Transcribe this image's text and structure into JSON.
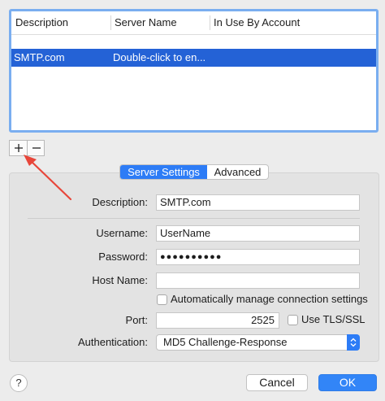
{
  "table": {
    "columns": [
      "Description",
      "Server Name",
      "In Use By Account"
    ],
    "rows": [
      {
        "description": "SMTP.com",
        "server_name": "Double-click to en...",
        "in_use_by": "",
        "selected": true
      }
    ]
  },
  "list_buttons": {
    "add_label": "+",
    "remove_label": "−"
  },
  "tabs": {
    "server_settings": "Server Settings",
    "advanced": "Advanced",
    "selected": "Server Settings"
  },
  "form": {
    "description": {
      "label": "Description:",
      "value": "SMTP.com"
    },
    "username": {
      "label": "Username:",
      "value": "UserName"
    },
    "password": {
      "label": "Password:",
      "value": "●●●●●●●●●●"
    },
    "host_name": {
      "label": "Host Name:",
      "value": ""
    },
    "auto_manage": {
      "label": "Automatically manage connection settings",
      "checked": false
    },
    "port": {
      "label": "Port:",
      "value": "2525"
    },
    "use_tls": {
      "label": "Use TLS/SSL",
      "checked": false
    },
    "authentication": {
      "label": "Authentication:",
      "value": "MD5 Challenge-Response"
    }
  },
  "buttons": {
    "help": "?",
    "cancel": "Cancel",
    "ok": "OK"
  },
  "icons": {
    "add": "plus-icon",
    "remove": "minus-icon",
    "popup": "chevron-up-down-icon",
    "annotation": "red-arrow-annotation"
  },
  "colors": {
    "selection": "#2462d6",
    "accent": "#2d7cf6",
    "annotation_arrow": "#e8463a"
  }
}
